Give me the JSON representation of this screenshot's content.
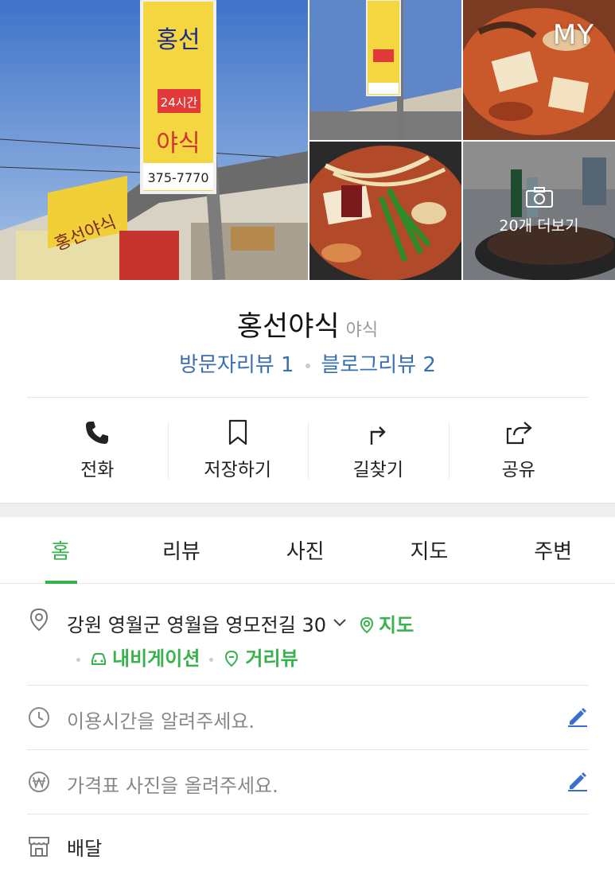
{
  "photos": {
    "my_badge": "MY",
    "more_label": "20개 더보기",
    "sign_top": "홍선",
    "sign_24": "24시간",
    "sign_name": "야식",
    "sign_phone": "375-7770",
    "banner_text": "홍선야식"
  },
  "place": {
    "name": "홍선야식",
    "category": "야식",
    "visitor_review": "방문자리뷰 1",
    "blog_review": "블로그리뷰 2"
  },
  "actions": [
    {
      "label": "전화",
      "icon": "phone-icon"
    },
    {
      "label": "저장하기",
      "icon": "bookmark-icon"
    },
    {
      "label": "길찾기",
      "icon": "directions-icon"
    },
    {
      "label": "공유",
      "icon": "share-icon"
    }
  ],
  "tabs": [
    {
      "label": "홈",
      "active": true
    },
    {
      "label": "리뷰",
      "active": false
    },
    {
      "label": "사진",
      "active": false
    },
    {
      "label": "지도",
      "active": false
    },
    {
      "label": "주변",
      "active": false
    }
  ],
  "info": {
    "address": "강원 영월군 영월읍 영모전길 30",
    "map_link": "지도",
    "navigation_link": "내비게이션",
    "streetview_link": "거리뷰",
    "hours_prompt": "이용시간을 알려주세요.",
    "price_prompt": "가격표 사진을 올려주세요.",
    "delivery": "배달"
  },
  "colors": {
    "accent_green": "#37b24d",
    "review_blue": "#3a6fb0"
  }
}
